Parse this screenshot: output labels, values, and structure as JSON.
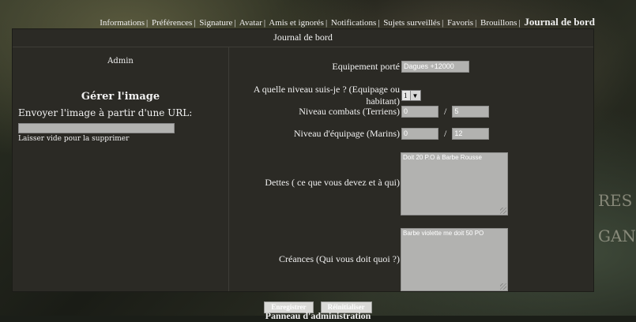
{
  "nav": {
    "items": [
      "Informations",
      "Préférences",
      "Signature",
      "Avatar",
      "Amis et ignorés",
      "Notifications",
      "Sujets surveillés",
      "Favoris",
      "Brouillons"
    ],
    "active": "Journal de bord"
  },
  "panel": {
    "title": "Journal de bord",
    "left": {
      "username": "Admin",
      "manage_title": "Gérer l'image",
      "url_label": "Envoyer l'image à partir d'une URL:",
      "url_value": "",
      "hint": "Laisser vide pour la supprimer"
    },
    "right": {
      "equipement_label": "Equipement porté",
      "equipement_value": "Dagues +12000",
      "niveau_label": "A quelle niveau suis-je ? (Equipage ou habitant)",
      "niveau_value": "1",
      "combats_label": "Niveau combats (Terriens)",
      "combats_value": "0",
      "combats_max": "5",
      "equipage_label": "Niveau d'équipage (Marins)",
      "equipage_value": "0",
      "equipage_max": "12",
      "dettes_label": "Dettes ( ce que vous devez et à qui)",
      "dettes_value": "Doit 20 P.O à Barbe Rousse",
      "creances_label": "Créances (Qui vous doit quoi ?)",
      "creances_value": "Barbe violette me doit 50 PO"
    }
  },
  "buttons": {
    "save": "Enregistrer",
    "reset": "Réinitialiser"
  },
  "footer": {
    "text": "Panneau d'administration"
  },
  "background": {
    "deco_right_1": "RES",
    "deco_right_2": "GANI"
  },
  "colors": {
    "panel": "#2b2a25",
    "field": "#b2b2b0",
    "text": "#f0f0f0"
  }
}
